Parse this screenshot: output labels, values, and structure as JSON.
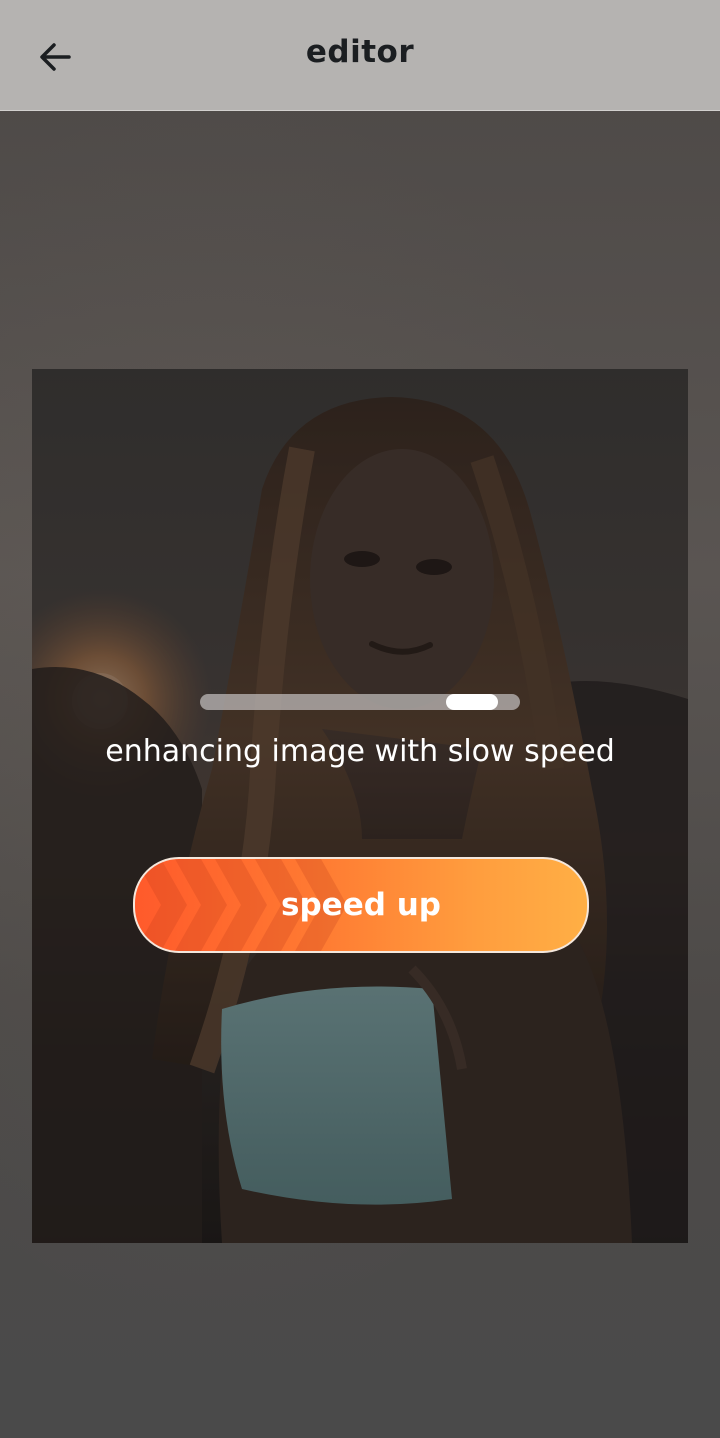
{
  "header": {
    "title": "editor",
    "back_icon": "arrow-left-icon"
  },
  "photo": {
    "description_icon": "photo-image"
  },
  "progress": {
    "value": 0.85
  },
  "status": {
    "text": "enhancing image with slow speed"
  },
  "action": {
    "label": "speed up",
    "icon": "chevrons-right-icon"
  },
  "colors": {
    "accent_start": "#ff5a2b",
    "accent_end": "#ffaf45",
    "topbar": "#b5b3b1",
    "title_text": "#1b1e21"
  }
}
